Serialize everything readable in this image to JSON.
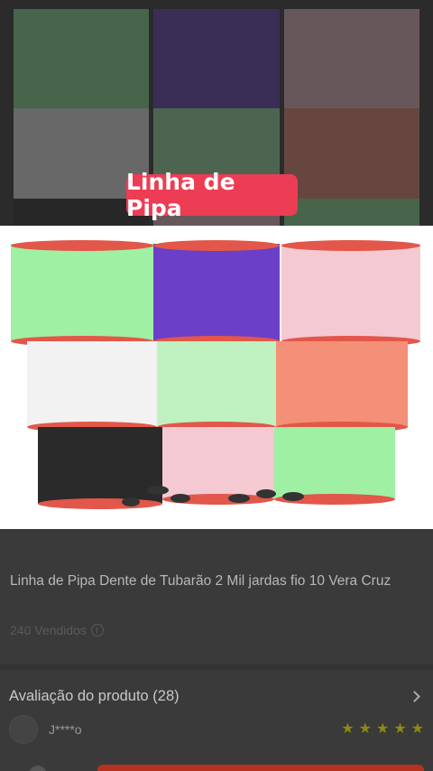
{
  "banner": {
    "title": "Linha de Pipa"
  },
  "product": {
    "title": "Linha de Pipa Dente de Tubarão 2 Mil jardas fio 10 Vera Cruz",
    "sold": "240 Vendidos"
  },
  "reviews": {
    "header": "Avaliação do produto (28)",
    "first_reviewer": "J****o",
    "rating": 5
  },
  "colors": {
    "banner_pill": "#ec3d55",
    "spool_green": "#9ff0a3",
    "spool_purple": "#6b3fc8",
    "spool_pink": "#f4c9d2",
    "spool_white": "#f2f2f2",
    "spool_salmon": "#f48f78",
    "spool_black": "#2a2a2a",
    "spool_rim": "#e2574a",
    "star": "#8a8a16"
  }
}
